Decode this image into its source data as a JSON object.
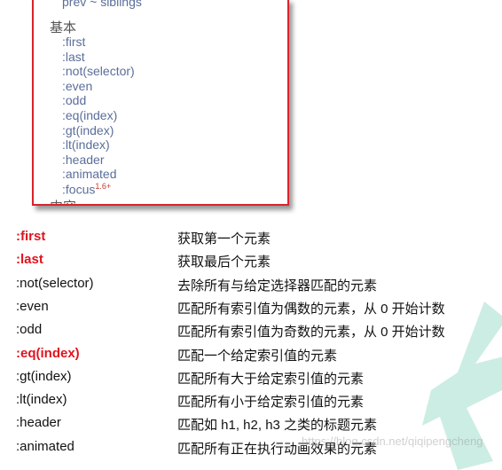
{
  "panel": {
    "top_item": "prev ~ siblings",
    "category": "基本",
    "next_category": "内容",
    "items": [
      ":first",
      ":last",
      ":not(selector)",
      ":even",
      ":odd",
      ":eq(index)",
      ":gt(index)",
      ":lt(index)",
      ":header",
      ":animated",
      ":focus"
    ],
    "focus_version": "1.6+"
  },
  "table": {
    "rows": [
      {
        "selector": ":first",
        "description": "获取第一个元素",
        "highlight": true
      },
      {
        "selector": ":last",
        "description": "获取最后个元素",
        "highlight": true
      },
      {
        "selector": ":not(selector)",
        "description": "去除所有与给定选择器匹配的元素",
        "highlight": false
      },
      {
        "selector": ":even",
        "description": "匹配所有索引值为偶数的元素，从 0 开始计数",
        "highlight": false
      },
      {
        "selector": ":odd",
        "description": "匹配所有索引值为奇数的元素，从 0 开始计数",
        "highlight": false
      },
      {
        "selector": ":eq(index)",
        "description": "匹配一个给定索引值的元素",
        "highlight": true
      },
      {
        "selector": ":gt(index)",
        "description": "匹配所有大于给定索引值的元素",
        "highlight": false
      },
      {
        "selector": ":lt(index)",
        "description": "匹配所有小于给定索引值的元素",
        "highlight": false
      },
      {
        "selector": ":header",
        "description": "匹配如 h1, h2, h3 之类的标题元素",
        "highlight": false
      },
      {
        "selector": ":animated",
        "description": "匹配所有正在执行动画效果的元素",
        "highlight": false
      }
    ]
  },
  "watermark": "https://blog.csdn.net/qiqipengcheng",
  "colors": {
    "highlight": "#e0141e",
    "frame": "#d9242b",
    "link": "#5a6e9a",
    "watermark_shape": "#bfe8dc"
  }
}
